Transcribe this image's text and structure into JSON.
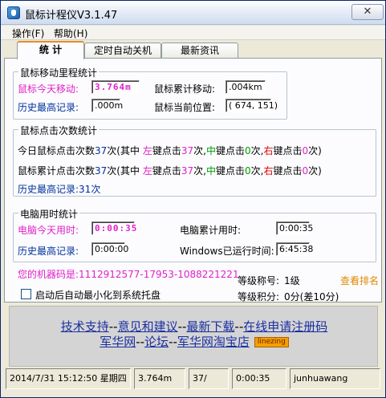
{
  "window": {
    "title": "鼠标计程仪V3.1.47",
    "close_glyph": "✕"
  },
  "menu": {
    "items": [
      "操作(F)",
      "帮助(H)"
    ]
  },
  "tabs": [
    {
      "label": "统  计",
      "active": true
    },
    {
      "label": "定时自动关机",
      "active": false
    },
    {
      "label": "最新资讯",
      "active": false
    }
  ],
  "mileage": {
    "title": "鼠标移动里程统计",
    "today_label": "鼠标今天移动:",
    "today_value": "3.764m",
    "total_label": "鼠标累计移动:",
    "total_value": ".004km",
    "record_label": "历史最高记录:",
    "record_value": ".000m",
    "position_label": "鼠标当前位置:",
    "position_value": "( 674, 151)"
  },
  "clicks": {
    "title": "鼠标点击次数统计",
    "today": {
      "prefix": "今日鼠标点击次数",
      "count": "37",
      "mid": "次(其中",
      "left_label": "左",
      "mid2": "键点击",
      "left_count": "37",
      "t1": "次,",
      "middle_label": "中",
      "t2": "键点击",
      "middle_count": "0",
      "t3": "次,",
      "right_label": "右",
      "t4": "键点击",
      "right_count": "0",
      "t5": "次)"
    },
    "total": {
      "prefix": "鼠标累计点击次数",
      "count": "37",
      "mid": "次(其中",
      "left_label": "左",
      "mid2": "键点击",
      "left_count": "37",
      "t1": "次,",
      "middle_label": "中",
      "t2": "键点击",
      "middle_count": "0",
      "t3": "次,",
      "right_label": "右",
      "t4": "键点击",
      "right_count": "0",
      "t5": "次)"
    },
    "record": "历史最高记录:31次"
  },
  "usage": {
    "title": "电脑用时统计",
    "today_label": "电脑今天用时:",
    "today_value": "0:00:35",
    "total_label": "电脑累计用时:",
    "total_value": "0:00:35",
    "record_label": "历史最高记录:",
    "record_value": "0:00:00",
    "windows_label": "Windows已运行时间:",
    "windows_value": "6:45:38"
  },
  "machine_code": "您的机器码是:1112912577-17953-1088221221",
  "level": {
    "rank_label": "等级称号:",
    "rank_value": "1级",
    "points_label": "等级积分:",
    "points_value": "0分(差10分)"
  },
  "ranking_link": "查看排名",
  "autostart_label": "启动后自动最小化到系统托盘",
  "links": {
    "row1": [
      "技术支持",
      "意见和建议",
      "最新下载",
      "在线申请注册码"
    ],
    "row2": [
      "军华网",
      "论坛",
      "军华网淘宝店"
    ],
    "separator": "--",
    "badge": "linezing"
  },
  "status": [
    "2014/7/31 15:12:50 星期四",
    "3.764m",
    "37/",
    "0:00:35",
    "junhuawang"
  ],
  "colors": {
    "accent_blue": "#00319c",
    "magenta": "#e020c8",
    "link": "#1a2fa0",
    "orange": "#e08a00"
  }
}
